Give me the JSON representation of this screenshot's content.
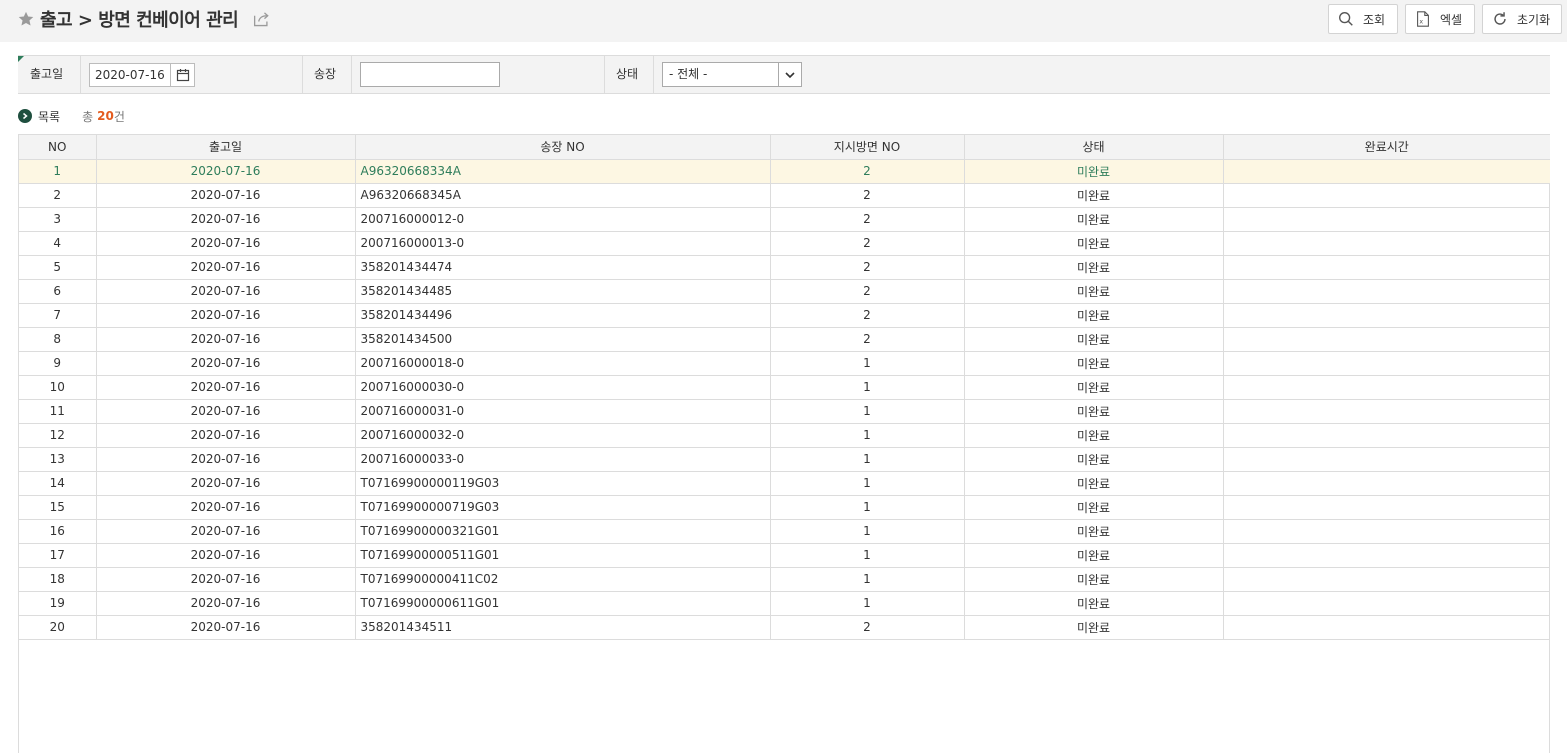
{
  "header": {
    "title": "출고 > 방면 컨베이어 관리",
    "buttons": {
      "search": "조회",
      "excel": "엑셀",
      "reset": "초기화"
    }
  },
  "filters": {
    "ship_date_label": "출고일",
    "ship_date_value": "2020-07-16",
    "invoice_label": "송장",
    "invoice_value": "",
    "status_label": "상태",
    "status_value": "- 전체 -"
  },
  "list": {
    "title": "목록",
    "total_prefix": "총",
    "total_count": "20",
    "total_suffix": "건"
  },
  "table": {
    "columns": [
      "NO",
      "출고일",
      "송장 NO",
      "지시방면 NO",
      "상태",
      "완료시간"
    ],
    "rows": [
      [
        "1",
        "2020-07-16",
        "A96320668334A",
        "2",
        "미완료",
        ""
      ],
      [
        "2",
        "2020-07-16",
        "A96320668345A",
        "2",
        "미완료",
        ""
      ],
      [
        "3",
        "2020-07-16",
        "200716000012-0",
        "2",
        "미완료",
        ""
      ],
      [
        "4",
        "2020-07-16",
        "200716000013-0",
        "2",
        "미완료",
        ""
      ],
      [
        "5",
        "2020-07-16",
        "358201434474",
        "2",
        "미완료",
        ""
      ],
      [
        "6",
        "2020-07-16",
        "358201434485",
        "2",
        "미완료",
        ""
      ],
      [
        "7",
        "2020-07-16",
        "358201434496",
        "2",
        "미완료",
        ""
      ],
      [
        "8",
        "2020-07-16",
        "358201434500",
        "2",
        "미완료",
        ""
      ],
      [
        "9",
        "2020-07-16",
        "200716000018-0",
        "1",
        "미완료",
        ""
      ],
      [
        "10",
        "2020-07-16",
        "200716000030-0",
        "1",
        "미완료",
        ""
      ],
      [
        "11",
        "2020-07-16",
        "200716000031-0",
        "1",
        "미완료",
        ""
      ],
      [
        "12",
        "2020-07-16",
        "200716000032-0",
        "1",
        "미완료",
        ""
      ],
      [
        "13",
        "2020-07-16",
        "200716000033-0",
        "1",
        "미완료",
        ""
      ],
      [
        "14",
        "2020-07-16",
        "T07169900000119G03",
        "1",
        "미완료",
        ""
      ],
      [
        "15",
        "2020-07-16",
        "T07169900000719G03",
        "1",
        "미완료",
        ""
      ],
      [
        "16",
        "2020-07-16",
        "T07169900000321G01",
        "1",
        "미완료",
        ""
      ],
      [
        "17",
        "2020-07-16",
        "T07169900000511G01",
        "1",
        "미완료",
        ""
      ],
      [
        "18",
        "2020-07-16",
        "T07169900000411C02",
        "1",
        "미완료",
        ""
      ],
      [
        "19",
        "2020-07-16",
        "T07169900000611G01",
        "1",
        "미완료",
        ""
      ],
      [
        "20",
        "2020-07-16",
        "358201434511",
        "2",
        "미완료",
        ""
      ]
    ]
  },
  "colors": {
    "accent": "#2e7d5b",
    "count": "#e35b1e",
    "selected_row": "#fdf7e3"
  }
}
